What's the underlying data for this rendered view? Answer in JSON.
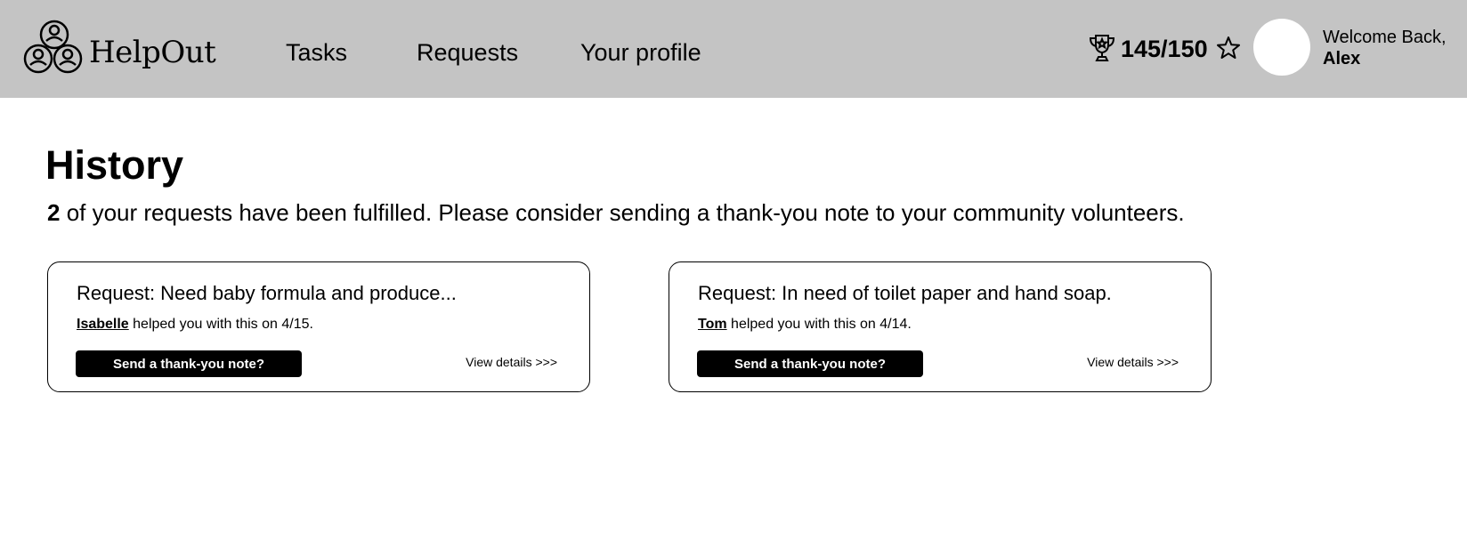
{
  "brand": {
    "name": "HelpOut"
  },
  "nav": {
    "items": [
      {
        "label": "Tasks"
      },
      {
        "label": "Requests"
      },
      {
        "label": "Your profile"
      }
    ]
  },
  "user": {
    "score": "145/150",
    "greeting": "Welcome Back,",
    "name": "Alex"
  },
  "icons": {
    "logo": "people-group-icon",
    "trophy": "trophy-icon",
    "star": "star-icon"
  },
  "page": {
    "title": "History",
    "summary_count": "2",
    "summary_text": " of your requests have been fulfilled. Please consider sending a thank-you note to your community volunteers."
  },
  "requests": [
    {
      "title": "Request: Need baby formula and produce...",
      "helper": "Isabelle",
      "helped_text": " helped you with this on 4/15.",
      "button_label": "Send a thank-you note?",
      "details_label": "View details >>>"
    },
    {
      "title": "Request: In need of toilet paper and hand soap.",
      "helper": "Tom",
      "helped_text": " helped you with this on 4/14.",
      "button_label": "Send a thank-you note?",
      "details_label": "View details >>>"
    }
  ]
}
